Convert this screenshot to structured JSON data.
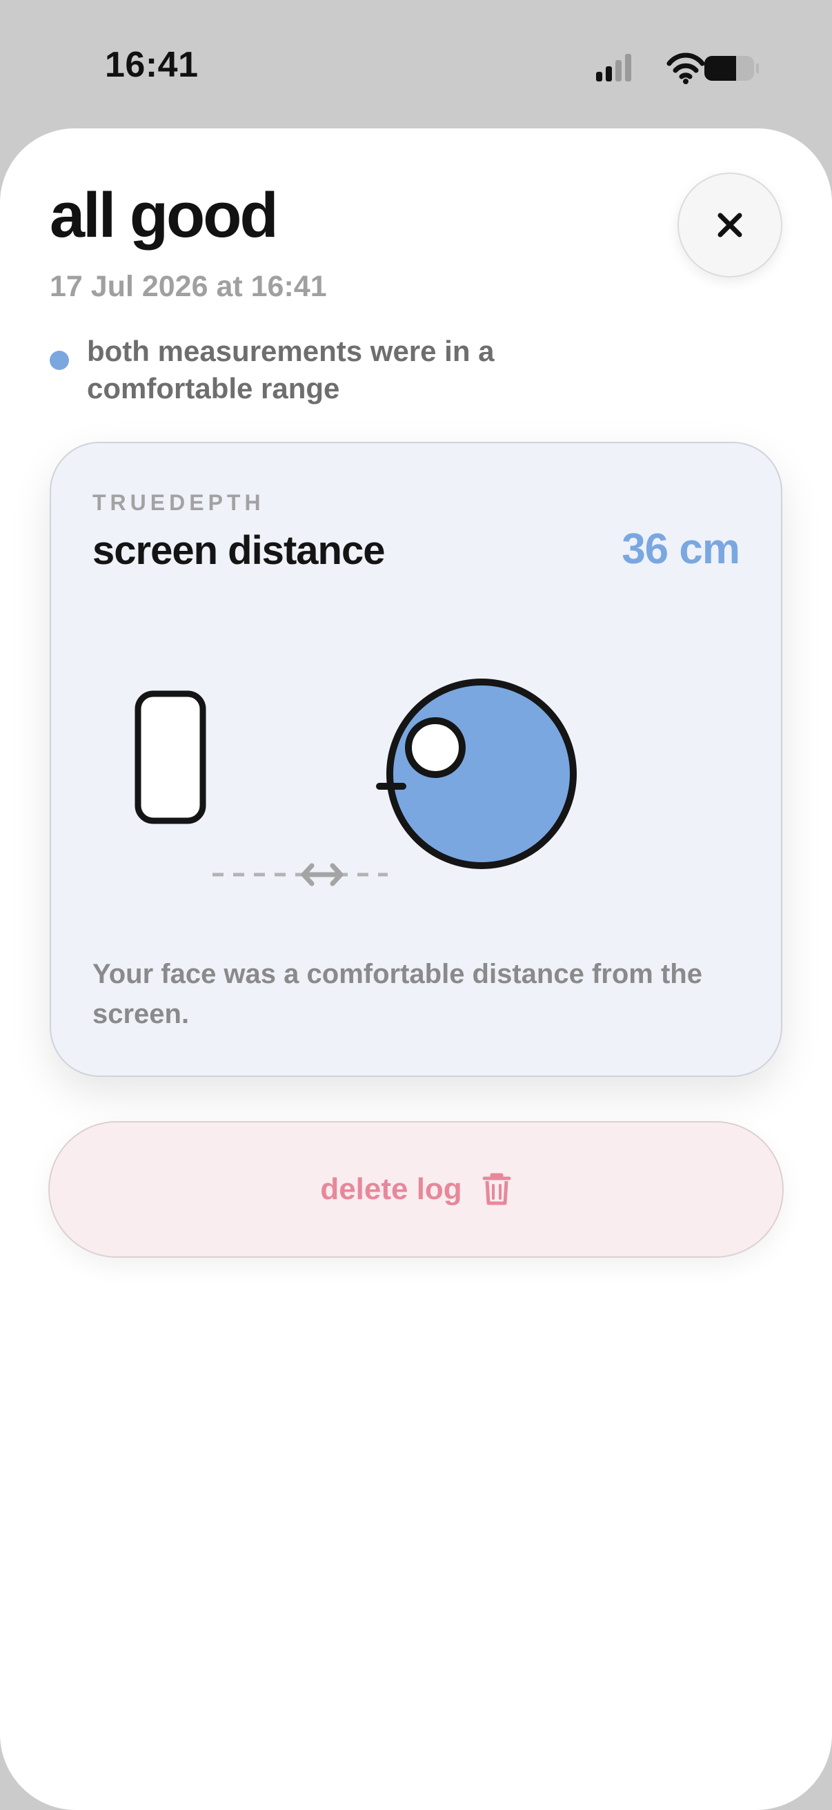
{
  "status_bar": {
    "time": "16:41",
    "icons": [
      "cellular-signal-icon",
      "wifi-icon",
      "battery-icon"
    ]
  },
  "sheet": {
    "title": "all good",
    "timestamp": "17 Jul 2026 at 16:41",
    "close_icon": "close-icon",
    "summary": {
      "indicator_color": "#7aa7e0",
      "text": "both measurements were in a comfortable range"
    }
  },
  "card": {
    "eyebrow": "TRUEDEPTH",
    "title": "screen distance",
    "value": "36 cm",
    "value_color": "#7aa7e0",
    "illustration_icons": [
      "phone-icon",
      "distance-arrow-icon",
      "face-icon"
    ],
    "face_color": "#7aa7e0",
    "description": "Your face was a comfortable distance from the screen."
  },
  "delete": {
    "label": "delete log",
    "icon": "trash-icon",
    "color": "#e7889a"
  }
}
